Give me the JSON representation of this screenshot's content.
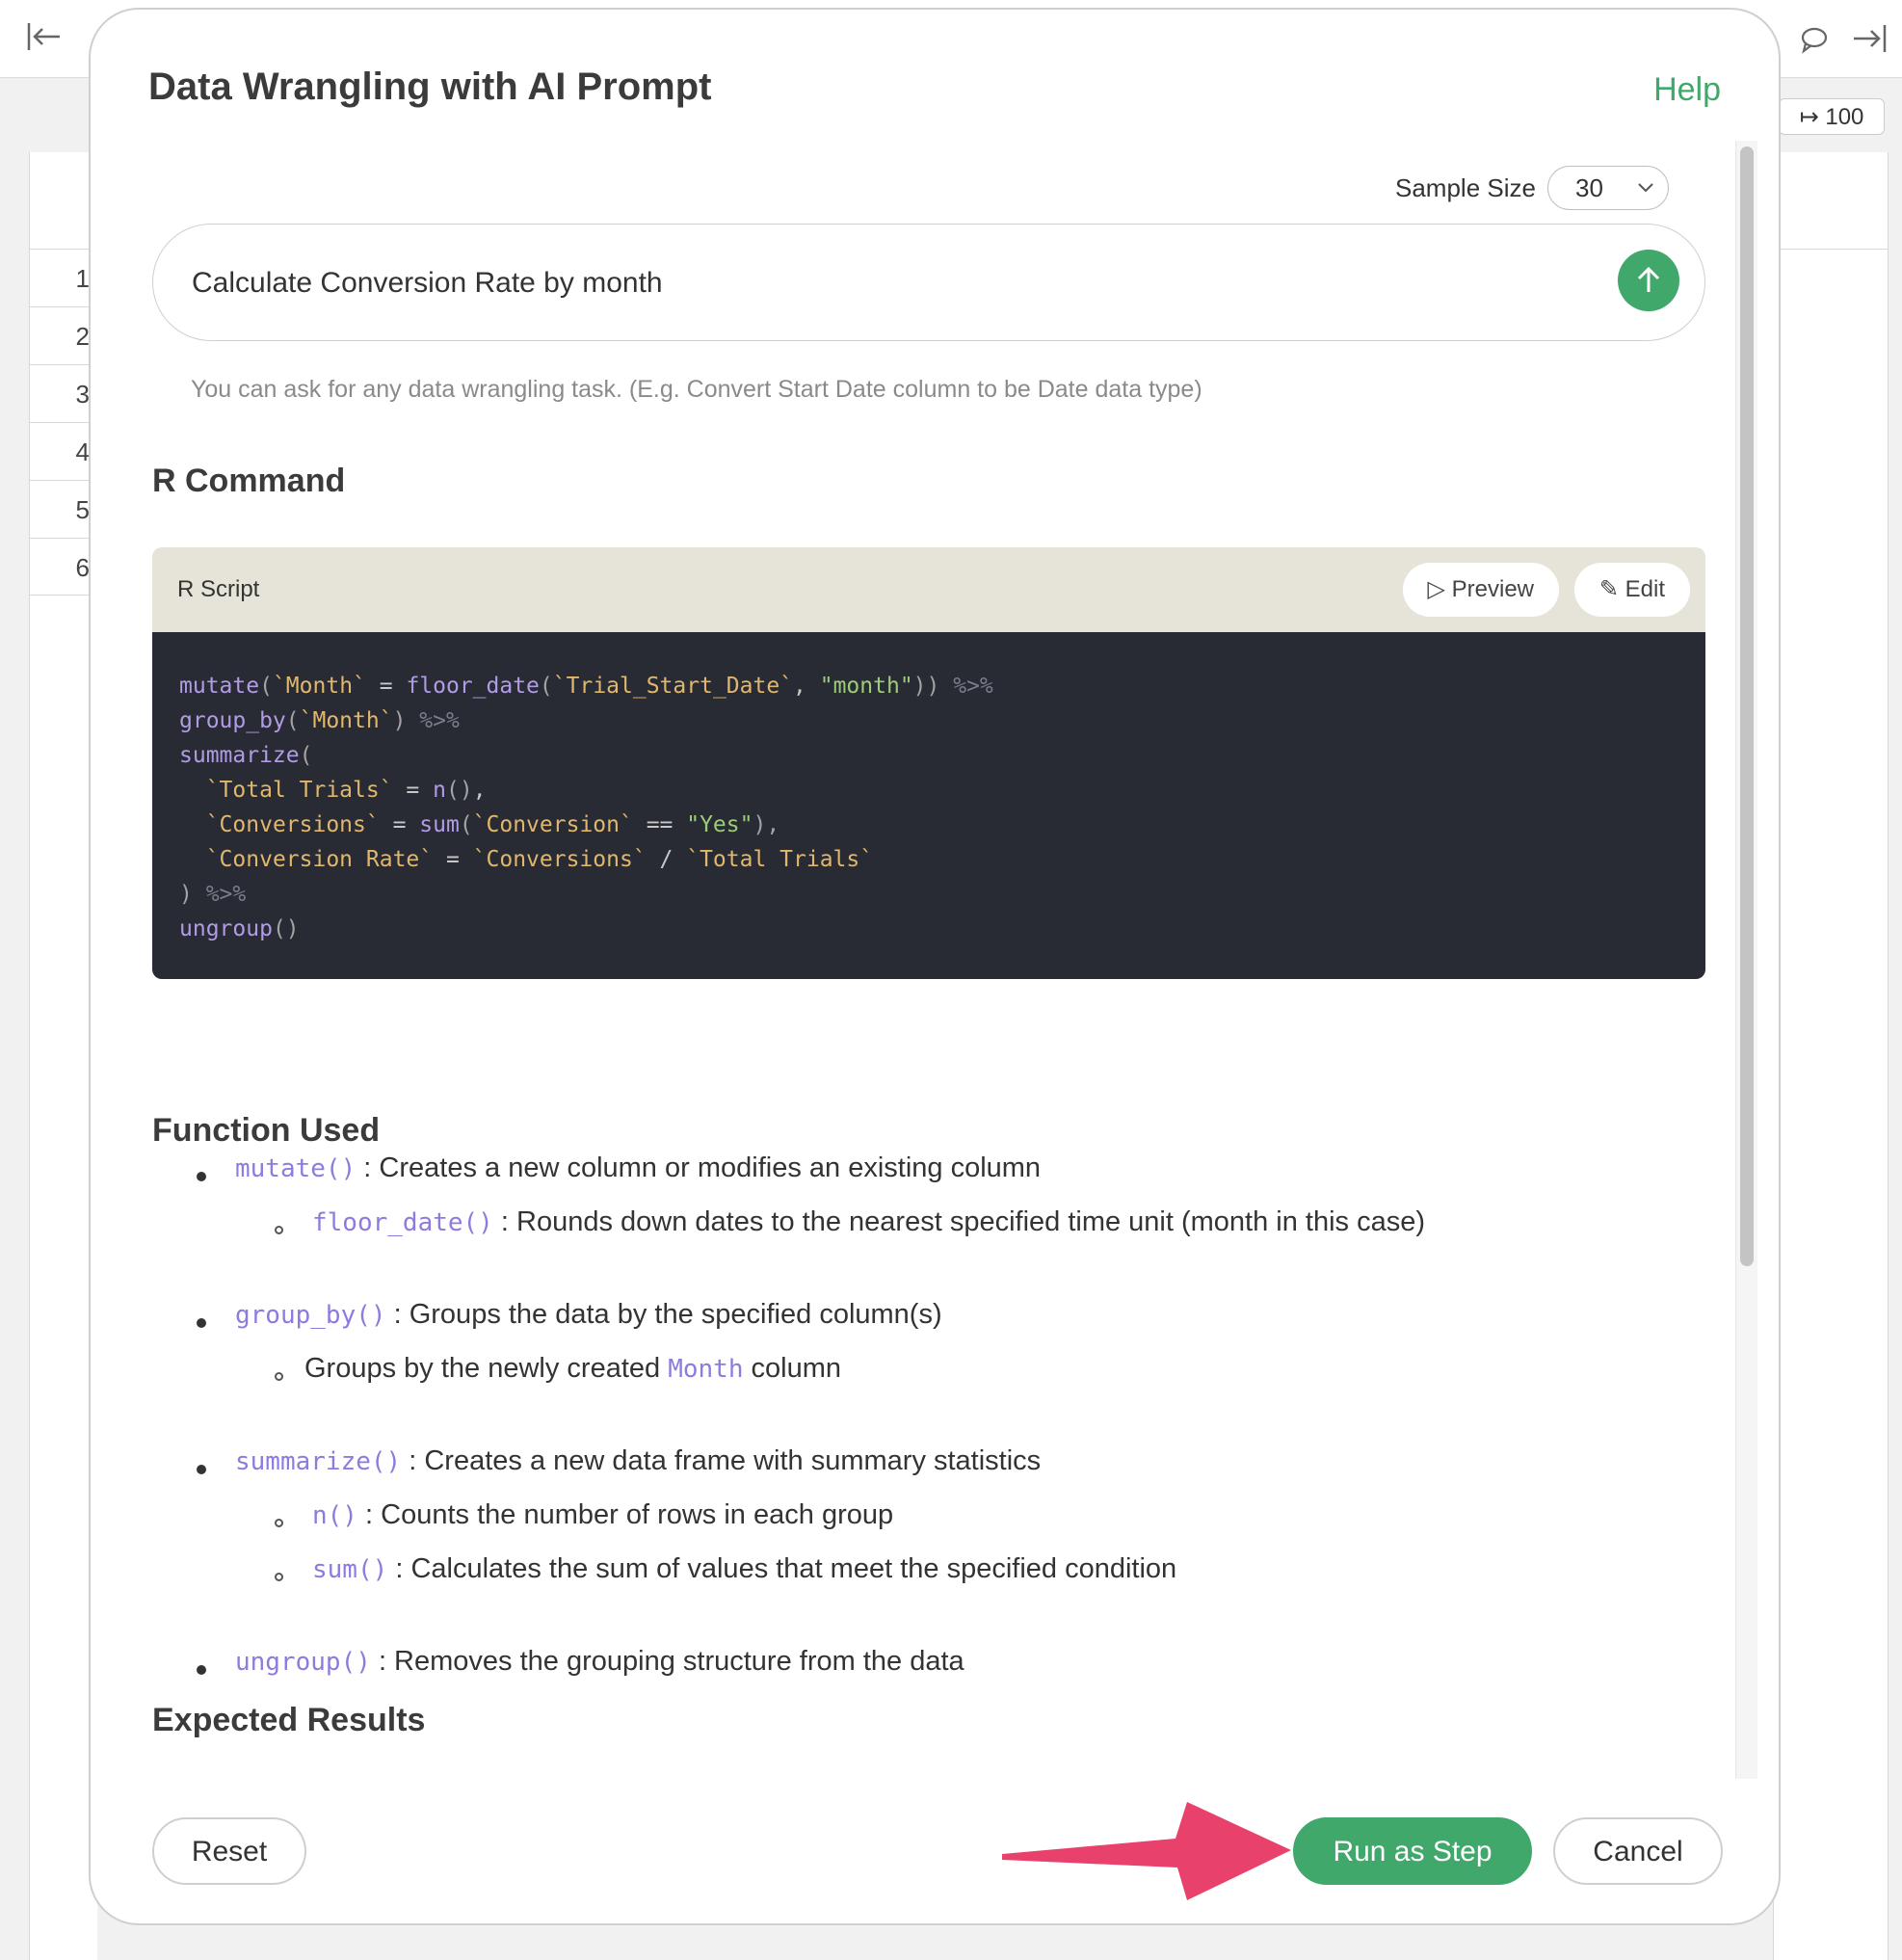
{
  "background": {
    "row_numbers": [
      "1",
      "2",
      "3",
      "4",
      "5",
      "6"
    ],
    "row_limit_label": "100"
  },
  "modal": {
    "title": "Data Wrangling with AI Prompt",
    "help_label": "Help",
    "sample_size": {
      "label": "Sample Size",
      "value": "30"
    },
    "prompt": {
      "value": "Calculate Conversion Rate by month",
      "hint": "You can ask for any data wrangling task. (E.g. Convert Start Date column to be Date data type)"
    },
    "r_command": {
      "title": "R Command",
      "script_label": "R Script",
      "preview_label": "Preview",
      "edit_label": "Edit",
      "code": [
        [
          {
            "t": "mutate",
            "c": "fn"
          },
          {
            "t": "(",
            "c": "punc"
          },
          {
            "t": "`Month`",
            "c": "bt"
          },
          {
            "t": " = ",
            "c": "op"
          },
          {
            "t": "floor_date",
            "c": "fn"
          },
          {
            "t": "(",
            "c": "punc"
          },
          {
            "t": "`Trial_Start_Date`",
            "c": "bt"
          },
          {
            "t": ", ",
            "c": "op"
          },
          {
            "t": "\"month\"",
            "c": "str"
          },
          {
            "t": "))",
            "c": "punc"
          },
          {
            "t": " %>%",
            "c": "pipe"
          }
        ],
        [
          {
            "t": "group_by",
            "c": "fn"
          },
          {
            "t": "(",
            "c": "punc"
          },
          {
            "t": "`Month`",
            "c": "bt"
          },
          {
            "t": ")",
            "c": "punc"
          },
          {
            "t": " %>%",
            "c": "pipe"
          }
        ],
        [
          {
            "t": "summarize",
            "c": "fn"
          },
          {
            "t": "(",
            "c": "punc"
          }
        ],
        [
          {
            "t": "  ",
            "c": "op"
          },
          {
            "t": "`Total Trials`",
            "c": "bt"
          },
          {
            "t": " = ",
            "c": "op"
          },
          {
            "t": "n",
            "c": "fn"
          },
          {
            "t": "()",
            "c": "punc"
          },
          {
            "t": ",",
            "c": "op"
          }
        ],
        [
          {
            "t": "  ",
            "c": "op"
          },
          {
            "t": "`Conversions`",
            "c": "bt"
          },
          {
            "t": " = ",
            "c": "op"
          },
          {
            "t": "sum",
            "c": "fn"
          },
          {
            "t": "(",
            "c": "punc"
          },
          {
            "t": "`Conversion`",
            "c": "bt"
          },
          {
            "t": " == ",
            "c": "op"
          },
          {
            "t": "\"Yes\"",
            "c": "str"
          },
          {
            "t": "),",
            "c": "punc"
          }
        ],
        [
          {
            "t": "  ",
            "c": "op"
          },
          {
            "t": "`Conversion Rate`",
            "c": "bt"
          },
          {
            "t": " = ",
            "c": "op"
          },
          {
            "t": "`Conversions`",
            "c": "bt"
          },
          {
            "t": " / ",
            "c": "op"
          },
          {
            "t": "`Total Trials`",
            "c": "bt"
          }
        ],
        [
          {
            "t": ")",
            "c": "punc"
          },
          {
            "t": " %>%",
            "c": "pipe"
          }
        ],
        [
          {
            "t": "ungroup",
            "c": "fn"
          },
          {
            "t": "()",
            "c": "punc"
          }
        ]
      ]
    },
    "function_used": {
      "title": "Function Used",
      "items": [
        {
          "fn": "mutate()",
          "desc": " : Creates a new column or modifies an existing column"
        },
        {
          "fn": "floor_date()",
          "desc": " : Rounds down dates to the nearest specified time unit (month in this case)"
        },
        {
          "fn": "group_by()",
          "desc": " : Groups the data by the specified column(s)"
        },
        {
          "pre": "Groups by the newly created ",
          "fn": "Month",
          "desc": " column"
        },
        {
          "fn": "summarize()",
          "desc": " : Creates a new data frame with summary statistics"
        },
        {
          "fn": "n()",
          "desc": " : Counts the number of rows in each group"
        },
        {
          "fn": "sum()",
          "desc": " : Calculates the sum of values that meet the specified condition"
        },
        {
          "fn": "ungroup()",
          "desc": " : Removes the grouping structure from the data"
        }
      ]
    },
    "expected_results": {
      "title": "Expected Results"
    },
    "footer": {
      "reset_label": "Reset",
      "run_label": "Run as Step",
      "cancel_label": "Cancel"
    }
  },
  "colors": {
    "accent_green": "#3fa86a",
    "annotation_arrow": "#e8416b",
    "code_bg": "#282b33"
  }
}
